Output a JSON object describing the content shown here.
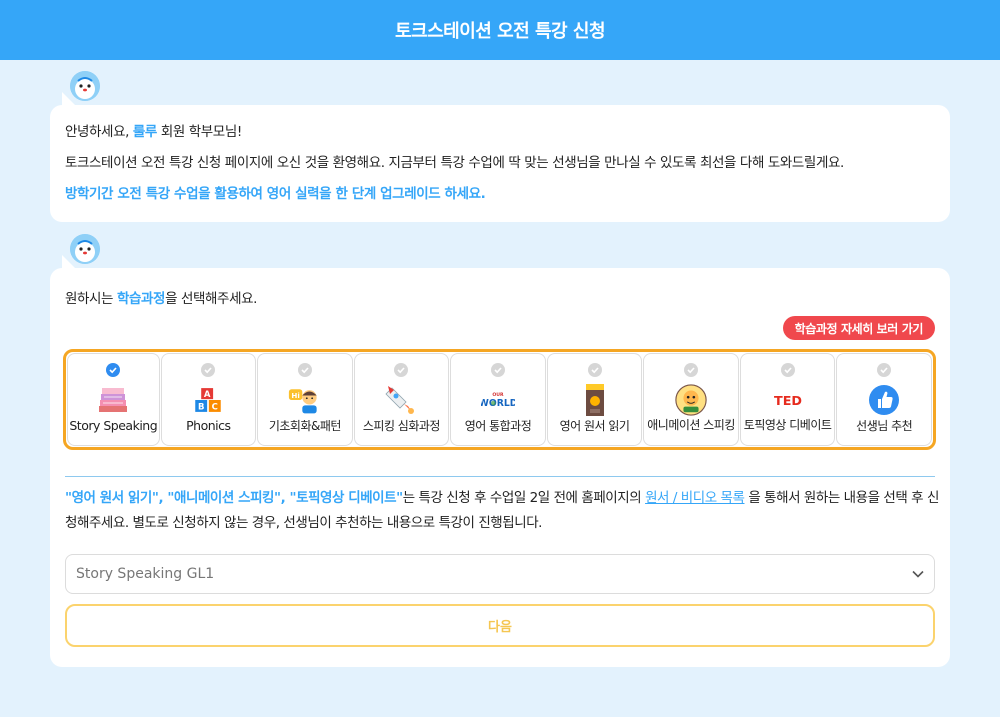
{
  "header": {
    "title": "토크스테이션 오전 특강 신청"
  },
  "greeting": {
    "line1_prefix": "안녕하세요, ",
    "user_name": "룰루",
    "line1_suffix": " 회원 학부모님!",
    "line2": "토크스테이션 오전 특강 신청 페이지에 오신 것을 환영해요. 지금부터 특강 수업에 딱 맞는 선생님을 만나실 수 있도록 최선을 다해 도와드릴게요.",
    "line3": "방학기간 오전 특강 수업을 활용하여 영어 실력을 한 단계 업그레이드 하세요."
  },
  "selection": {
    "prompt_prefix": "원하시는 ",
    "prompt_highlight": "학습과정",
    "prompt_suffix": "을 선택해주세요.",
    "detail_button": "학습과정 자세히 보러 가기",
    "courses": [
      {
        "label": "Story Speaking",
        "icon": "story-books-icon",
        "selected": true
      },
      {
        "label": "Phonics",
        "icon": "abc-blocks-icon",
        "selected": false
      },
      {
        "label": "기초회화&패턴",
        "icon": "hi-boy-icon",
        "selected": false
      },
      {
        "label": "스피킹 심화과정",
        "icon": "rocket-icon",
        "selected": false
      },
      {
        "label": "영어 통합과정",
        "icon": "our-world-icon",
        "selected": false
      },
      {
        "label": "영어 원서 읽기",
        "icon": "book-cover-icon",
        "selected": false
      },
      {
        "label": "애니메이션 스피킹",
        "icon": "animation-character-icon",
        "selected": false
      },
      {
        "label": "토픽영상 디베이트",
        "icon": "ted-icon",
        "selected": false
      },
      {
        "label": "선생님 추천",
        "icon": "thumbs-up-icon",
        "selected": false
      }
    ]
  },
  "notice": {
    "highlight": "\"영어 원서 읽기\", \"애니메이션 스피킹\", \"토픽영상 디베이트\"",
    "text1": "는 특강 신청 후 수업일 2일 전에 홈페이지의 ",
    "link": "원서 / 비디오 목록",
    "text2": " 을 통해서 원하는 내용을 선택 후 신청해주세요. 별도로 신청하지 않는 경우, 선생님이 추천하는 내용으로 특강이 진행됩니다."
  },
  "level_select": {
    "value": "Story Speaking GL1"
  },
  "next_button": {
    "label": "다음"
  },
  "colors": {
    "primary": "#35a6f8",
    "accent_orange": "#f5a623",
    "red": "#f0484d"
  }
}
